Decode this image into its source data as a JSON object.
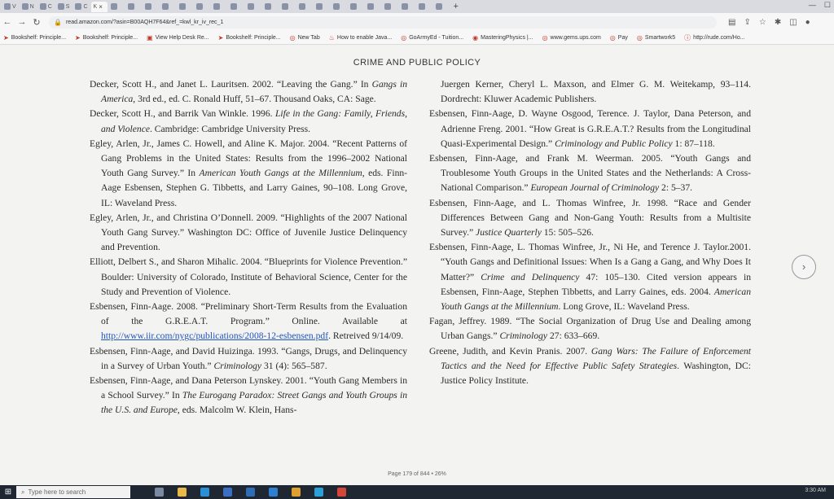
{
  "browser": {
    "tabs": [
      "V",
      "N",
      "C",
      "S",
      "C",
      "K"
    ],
    "active_tab_close": "×",
    "new_tab": "+",
    "url": "read.amazon.com/?asin=B00AQH7F64&ref_=kwl_kr_iv_rec_1"
  },
  "bookmarks": [
    "Bookshelf: Principle...",
    "Bookshelf: Principle...",
    "View Help Desk Re...",
    "Bookshelf: Principle...",
    "New Tab",
    "How to enable Java...",
    "GoArmyEd - Tuition...",
    "MasteringPhysics |...",
    "www.gems.ups.com",
    "Pay",
    "Smartwork5",
    "http://rude.com/Ho..."
  ],
  "document": {
    "running_head": "CRIME AND PUBLIC POLICY",
    "page_info": "Page 179 of 844 • 26%",
    "left": [
      {
        "a": "Decker, Scott H., and Janet L. Lauritsen. 2002. “Leaving the Gang.” In ",
        "b": "Gangs in America",
        "c": ", 3rd ed., ed. C. Ronald Huff, 51–67. Thousand Oaks, CA: Sage."
      },
      {
        "a": "Decker, Scott H., and Barrik Van Winkle. 1996. ",
        "b": "Life in the Gang: Family, Friends, and Violence",
        "c": ". Cambridge: Cambridge University Press."
      },
      {
        "a": "Egley, Arlen, Jr., James C. Howell, and Aline K. Major. 2004. “Recent Patterns of Gang Problems in the United States: Results from the 1996–2002 National Youth Gang Survey.” In ",
        "b": "American Youth Gangs at the Millennium",
        "c": ", eds. Finn-Aage Esbensen, Stephen G. Tibbetts, and Larry Gaines, 90–108. Long Grove, IL: Waveland Press."
      },
      {
        "a": "Egley, Arlen, Jr., and Christina O’Donnell. 2009. “Highlights of the 2007 National Youth Gang Survey.” Washington DC: Office of Juvenile Justice Delinquency and Prevention.",
        "b": "",
        "c": ""
      },
      {
        "a": "Elliott, Delbert S., and Sharon Mihalic. 2004. “Blueprints for Violence Prevention.” Boulder: University of Colorado, Institute of Behavioral Science, Center for the Study and Prevention of Violence.",
        "b": "",
        "c": ""
      },
      {
        "a": "Esbensen, Finn-Aage. 2008. “Preliminary Short-Term Results from the Evaluation of the G.R.E.A.T. Program.” Online. Available at ",
        "link": "http://www.iir.com/nygc/publications/2008-12-esbensen.pdf",
        "c": ". Retreived 9/14/09."
      },
      {
        "a": "Esbensen, Finn-Aage, and David Huizinga. 1993. “Gangs, Drugs, and Delinquency in a Survey of Urban Youth.” ",
        "b": "Criminology",
        "c": " 31 (4): 565–587."
      },
      {
        "a": "Esbensen, Finn-Aage, and Dana Peterson Lynskey. 2001. “Youth Gang Members in a School Survey.” In ",
        "b": "The Eurogang Paradox: Street Gangs and Youth Groups in the U.S. and Europe",
        "c": ", eds. Malcolm W. Klein, Hans-"
      }
    ],
    "right": [
      {
        "a": "Juergen Kerner, Cheryl L. Maxson, and Elmer G. M. Weitekamp, 93–114. Dordrecht: Kluwer Academic Publishers.",
        "b": "",
        "c": "",
        "cont": true
      },
      {
        "a": "Esbensen, Finn-Aage, D. Wayne Osgood, Terence. J. Taylor, Dana Peterson, and Adrienne Freng. 2001. “How Great is G.R.E.A.T.? Results from the Longitudinal Quasi-Experimental Design.” ",
        "b": "Criminology and Public Policy",
        "c": " 1: 87–118."
      },
      {
        "a": "Esbensen, Finn-Aage, and Frank M. Weerman. 2005. “Youth Gangs and Troublesome Youth Groups in the United States and the Netherlands: A Cross-National Comparison.” ",
        "b": "European Journal of Criminology",
        "c": " 2: 5–37."
      },
      {
        "a": "Esbensen, Finn-Aage, and L. Thomas Winfree, Jr. 1998. “Race and Gender Differences Between Gang and Non-Gang Youth: Results from a Multisite Survey.” ",
        "b": "Justice Quarterly",
        "c": " 15: 505–526."
      },
      {
        "a": "Esbensen, Finn-Aage, L. Thomas Winfree, Jr., Ni He, and Terence J. Taylor.2001. “Youth Gangs and Definitional Issues: When Is a Gang a Gang, and Why Does It Matter?” ",
        "b": "Crime and Delinquency",
        "c": " 47: 105–130. Cited version appears in Esbensen, Finn-Aage, Stephen Tibbetts, and Larry Gaines, eds. 2004. "
      },
      {
        "a": "",
        "b": "",
        "c": ""
      },
      {
        "a": "Fagan, Jeffrey. 1989. “The Social Organization of Drug Use and Dealing among Urban Gangs.” ",
        "b": "Criminology",
        "c": " 27: 633–669."
      },
      {
        "a": "Greene, Judith, and Kevin Pranis. 2007. ",
        "b": "Gang Wars: The Failure of Enforcement Tactics and the Need for Effective Public Safety Strategies",
        "c": ". Washington, DC: Justice Policy Institute."
      }
    ],
    "r5_tail_b": "American Youth Gangs at the Millennium",
    "r5_tail_c": ". Long Grove, IL: Waveland Press."
  },
  "taskbar": {
    "search_placeholder": "Type here to search",
    "time": "3:30 AM"
  }
}
